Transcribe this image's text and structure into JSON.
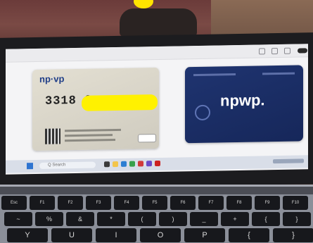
{
  "photo": {
    "subject": "",
    "background_colors": {
      "cloth": "#7a4a45",
      "yellow_marker": "#ffe400"
    }
  },
  "screen": {
    "search_placeholder": "",
    "left_card": {
      "brand": "np·vp",
      "number_prefix": "3318 0",
      "qr_icon": "qr-code-icon"
    },
    "right_card": {
      "brand": "npwp."
    }
  },
  "taskbar": {
    "search_label": "Q  Search",
    "icons": [
      "windows-start-icon",
      "search-icon",
      "folder-icon",
      "edge-icon",
      "chrome-icon",
      "store-icon",
      "mail-icon"
    ]
  },
  "keyboard": {
    "row_top": [
      "Esc",
      "F1",
      "F2",
      "F3",
      "F4",
      "F5",
      "F6",
      "F7",
      "F8",
      "F9",
      "F10"
    ],
    "row_mid": [
      "~",
      "%",
      "&",
      "*",
      "(",
      ")",
      "_",
      "+",
      "{",
      "}"
    ],
    "row_bottom": [
      "Y",
      "U",
      "I",
      "O",
      "P",
      "{",
      "}"
    ]
  }
}
